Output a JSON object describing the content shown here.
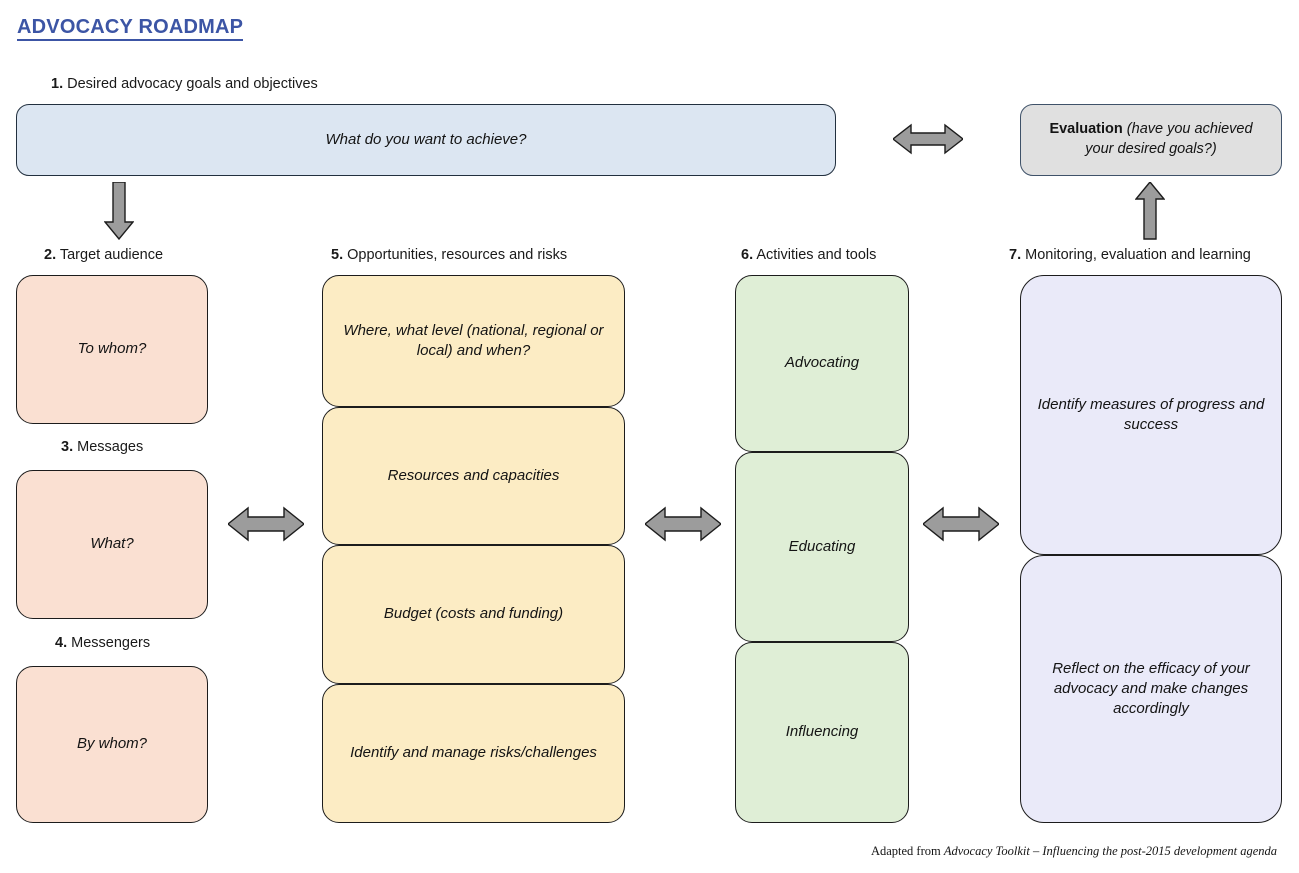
{
  "title": "ADVOCACY ROADMAP",
  "accent_color": "#3c55a5",
  "sections": {
    "s1": {
      "num": "1.",
      "label": " Desired advocacy goals and objectives"
    },
    "s2": {
      "num": "2.",
      "label": " Target audience"
    },
    "s3": {
      "num": "3.",
      "label": " Messages"
    },
    "s4": {
      "num": "4.",
      "label": " Messengers"
    },
    "s5": {
      "num": "5.",
      "label": " Opportunities, resources and risks"
    },
    "s6": {
      "num": "6.",
      "label": " Activities and tools"
    },
    "s7": {
      "num": "7.",
      "label": " Monitoring, evaluation and learning"
    }
  },
  "boxes": {
    "goal": {
      "text": "What do you want to achieve?",
      "color": "#dce6f2"
    },
    "evaluation": {
      "bold": "Evaluation ",
      "italic": "(have you achieved your desired goals?)",
      "color": "#e0e0e0"
    },
    "audience": {
      "text": "To whom?",
      "color": "#fae0d2"
    },
    "messages": {
      "text": "What?",
      "color": "#fae0d2"
    },
    "messengers": {
      "text": "By whom?",
      "color": "#fae0d2"
    },
    "opp_where": {
      "text": "Where, what level (national, regional or local) and when?",
      "color": "#fcecc4"
    },
    "opp_resources": {
      "text": "Resources and capacities",
      "color": "#fcecc4"
    },
    "opp_budget": {
      "text": "Budget (costs and funding)",
      "color": "#fcecc4"
    },
    "opp_risks": {
      "text": "Identify and manage risks/challenges",
      "color": "#fcecc4"
    },
    "act_advocating": {
      "text": "Advocating",
      "color": "#dfeed6"
    },
    "act_educating": {
      "text": "Educating",
      "color": "#dfeed6"
    },
    "act_influencing": {
      "text": "Influencing",
      "color": "#dfeed6"
    },
    "mel_measures": {
      "text": "Identify measures of progress and success",
      "color": "#eaeaf9"
    },
    "mel_reflect": {
      "text": "Reflect on the efficacy of your advocacy and make changes accordingly",
      "color": "#eaeaf9"
    }
  },
  "arrows": {
    "fill": "#9c9c9c",
    "stroke": "#1c1c1c",
    "down_goal_to_audience": "down-arrow",
    "goal_to_evaluation": "double-arrow-horizontal",
    "mel_to_evaluation": "up-arrow",
    "audience_to_opportunities": "double-arrow-horizontal",
    "opportunities_to_activities": "double-arrow-horizontal",
    "activities_to_mel": "double-arrow-horizontal"
  },
  "source_note": {
    "prefix": "Adapted from ",
    "italic": "Advocacy Toolkit – Influencing the post-2015 development agenda"
  }
}
